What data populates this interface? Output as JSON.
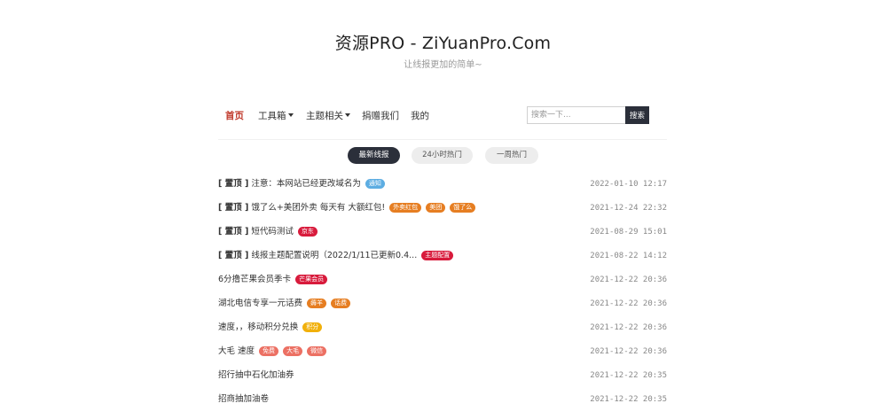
{
  "site": {
    "title": "资源PRO - ZiYuanPro.Com",
    "subtitle": "让线报更加的简单~"
  },
  "nav": {
    "items": [
      {
        "label": "首页",
        "active": true,
        "dropdown": false
      },
      {
        "label": "工具箱",
        "active": false,
        "dropdown": true
      },
      {
        "label": "主题相关",
        "active": false,
        "dropdown": true
      },
      {
        "label": "捐赠我们",
        "active": false,
        "dropdown": false
      },
      {
        "label": "我的",
        "active": false,
        "dropdown": false
      }
    ],
    "search": {
      "placeholder": "搜索一下...",
      "button_label": "搜索"
    }
  },
  "tabs": [
    {
      "label": "最新线报",
      "active": true
    },
    {
      "label": "24小时热门",
      "active": false
    },
    {
      "label": "一周热门",
      "active": false
    }
  ],
  "colors": {
    "accent_red": "#c0392b",
    "dark": "#2b2f3a",
    "badge_blue": "#5dade2",
    "badge_orange": "#e67e22",
    "badge_red": "#d81b3c",
    "badge_salmon": "#ec7063",
    "badge_yellow": "#f1b00b"
  },
  "posts": [
    {
      "pin": "[ 置顶 ]",
      "title": "注意：本网站已经更改域名为",
      "tags": [
        {
          "text": "通知",
          "color": "#5dade2"
        }
      ],
      "time": "2022-01-10 12:17"
    },
    {
      "pin": "[ 置顶 ]",
      "title": "饿了么+美团外卖 每天有 大额红包!",
      "tags": [
        {
          "text": "外卖红包",
          "color": "#e67e22"
        },
        {
          "text": "美团",
          "color": "#e67e22"
        },
        {
          "text": "饿了么",
          "color": "#e67e22"
        }
      ],
      "time": "2021-12-24 22:32"
    },
    {
      "pin": "[ 置顶 ]",
      "title": "短代码测试",
      "tags": [
        {
          "text": "京东",
          "color": "#d81b3c"
        }
      ],
      "time": "2021-08-29 15:01"
    },
    {
      "pin": "[ 置顶 ]",
      "title": "线报主题配置说明（2022/1/11已更新0.4...",
      "tags": [
        {
          "text": "主题配置",
          "color": "#d81b3c"
        }
      ],
      "time": "2021-08-22 14:12"
    },
    {
      "pin": "",
      "title": "6分撸芒果会员季卡",
      "tags": [
        {
          "text": "芒果会员",
          "color": "#d81b3c"
        }
      ],
      "time": "2021-12-22 20:36"
    },
    {
      "pin": "",
      "title": "湖北电信专享一元话费",
      "tags": [
        {
          "text": "薅羊",
          "color": "#e67e22"
        },
        {
          "text": "话费",
          "color": "#e67e22"
        }
      ],
      "time": "2021-12-22 20:36"
    },
    {
      "pin": "",
      "title": "速度，，移动积分兑换",
      "tags": [
        {
          "text": "积分",
          "color": "#f1b00b"
        }
      ],
      "time": "2021-12-22 20:36"
    },
    {
      "pin": "",
      "title": "大毛 速度",
      "tags": [
        {
          "text": "免费",
          "color": "#ec7063"
        },
        {
          "text": "大毛",
          "color": "#ec7063"
        },
        {
          "text": "微信",
          "color": "#ec7063"
        }
      ],
      "time": "2021-12-22 20:36"
    },
    {
      "pin": "",
      "title": "招行抽中石化加油券",
      "tags": [],
      "time": "2021-12-22 20:35"
    },
    {
      "pin": "",
      "title": "招商抽加油卷",
      "tags": [],
      "time": "2021-12-22 20:35"
    }
  ]
}
